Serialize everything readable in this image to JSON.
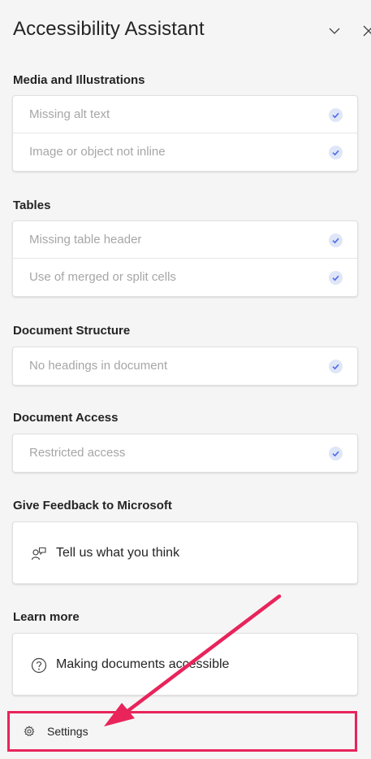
{
  "header": {
    "title": "Accessibility Assistant"
  },
  "sections": {
    "media": {
      "title": "Media and Illustrations",
      "items": [
        {
          "label": "Missing alt text"
        },
        {
          "label": "Image or object not inline"
        }
      ]
    },
    "tables": {
      "title": "Tables",
      "items": [
        {
          "label": "Missing table header"
        },
        {
          "label": "Use of merged or split cells"
        }
      ]
    },
    "structure": {
      "title": "Document Structure",
      "items": [
        {
          "label": "No headings in document"
        }
      ]
    },
    "access": {
      "title": "Document Access",
      "items": [
        {
          "label": "Restricted access"
        }
      ]
    }
  },
  "feedback": {
    "title": "Give Feedback to Microsoft",
    "link": "Tell us what you think"
  },
  "learn": {
    "title": "Learn more",
    "link": "Making documents accessible"
  },
  "settings": {
    "label": "Settings"
  },
  "colors": {
    "accent": "#e8245b",
    "check": "#4f6bed",
    "check_bg": "#dfe6f7"
  }
}
